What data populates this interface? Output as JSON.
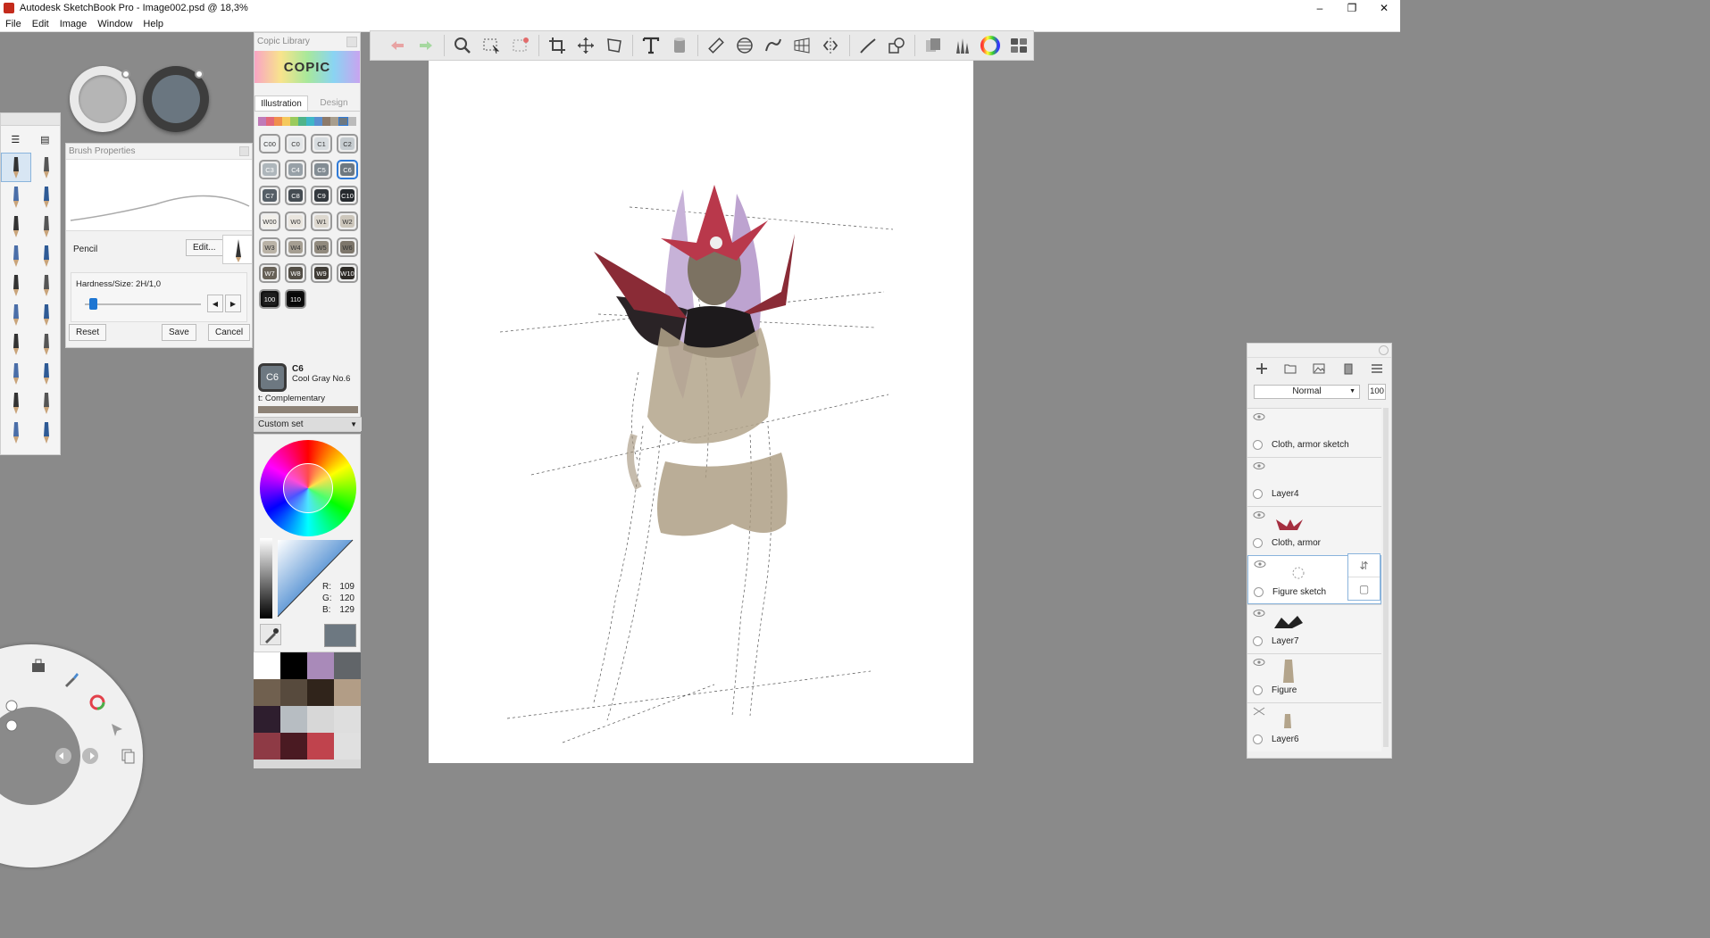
{
  "window": {
    "title": "Autodesk SketchBook Pro - Image002.psd @ 18,3%"
  },
  "menu": [
    "File",
    "Edit",
    "Image",
    "Window",
    "Help"
  ],
  "brush_properties": {
    "title": "Brush Properties",
    "brush_name": "Pencil",
    "edit_label": "Edit...",
    "hardness_label": "Hardness/Size: 2H/1,0",
    "reset_label": "Reset",
    "save_label": "Save",
    "cancel_label": "Cancel"
  },
  "copic": {
    "title": "Copic Library",
    "logo": "COPIC",
    "tabs": [
      "Illustration",
      "Design"
    ],
    "swatches": [
      "C00",
      "C0",
      "C1",
      "C2",
      "C3",
      "C4",
      "C5",
      "C6",
      "C7",
      "C8",
      "C9",
      "C10",
      "W00",
      "W0",
      "W1",
      "W2",
      "W3",
      "W4",
      "W5",
      "W6",
      "W7",
      "W8",
      "W9",
      "W10",
      "100",
      "110"
    ],
    "swatch_colors": [
      "#eef0f1",
      "#e4e7e9",
      "#d8dde0",
      "#c6ccd0",
      "#aeb6bb",
      "#97a0a7",
      "#828c93",
      "#6d7881",
      "#555e66",
      "#454c52",
      "#34393e",
      "#25292d",
      "#f1efea",
      "#eae6df",
      "#ddd8cf",
      "#cdc7bc",
      "#b9b2a6",
      "#a59e92",
      "#918a7e",
      "#7d766b",
      "#676157",
      "#534e46",
      "#403c36",
      "#2d2a26",
      "#1d1d1d",
      "#080808"
    ],
    "selected": "C6",
    "current_code": "C6",
    "current_chip": "C6",
    "current_name": "Cool Gray No.6",
    "complementary": "t: Complementary",
    "custom_set": "Custom set"
  },
  "color_editor": {
    "r_label": "R:",
    "r": "109",
    "g_label": "G:",
    "g": "120",
    "b_label": "B:",
    "b": "129"
  },
  "custom_swatches": [
    "#ffffff",
    "#000000",
    "#a98ab9",
    "#616569",
    "#70604f",
    "#574a3d",
    "#30241b",
    "#b29d86",
    "#2e1e2e",
    "#b7bdc2",
    "#d7d7d7",
    "#dedede",
    "#8e3a45",
    "#4a1a22",
    "#c0434d",
    "#e0e0e0"
  ],
  "layers": {
    "blend_mode": "Normal",
    "opacity": "100",
    "items": [
      {
        "name": "Cloth, armor sketch",
        "selected": false
      },
      {
        "name": "Layer4",
        "selected": false
      },
      {
        "name": "Cloth, armor",
        "selected": false
      },
      {
        "name": "Figure sketch",
        "selected": true
      },
      {
        "name": "Layer7",
        "selected": false
      },
      {
        "name": "Figure",
        "selected": false
      },
      {
        "name": "Layer6",
        "selected": false
      }
    ]
  }
}
